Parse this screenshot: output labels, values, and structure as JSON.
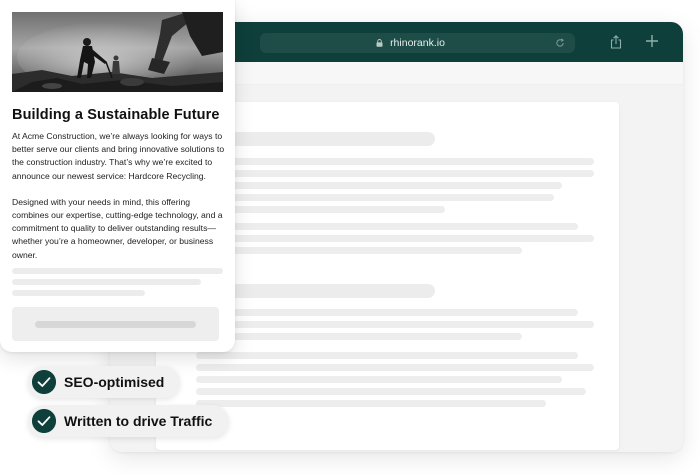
{
  "browser": {
    "url": "rhinorank.io",
    "icons": [
      "lock-icon",
      "reload-icon",
      "share-icon",
      "plus-icon"
    ],
    "bar_color": "#0e3f3a"
  },
  "card": {
    "title": "Building a Sustainable Future",
    "paragraphs": [
      "At Acme Construction, we’re always looking for ways to better serve our clients and bring innovative solutions to the construction industry. That’s why we’re excited to announce our newest service: Hardcore Recycling.",
      "Designed with your needs in mind, this offering combines our expertise, cutting-edge technology, and a commitment to quality to deliver outstanding results—whether you’re a homeowner, developer, or business owner."
    ]
  },
  "badges": [
    {
      "label": "SEO-optimised",
      "icon": "check-icon"
    },
    {
      "label": "Written to drive Traffic",
      "icon": "check-icon"
    }
  ],
  "colors": {
    "accent": "#0e3f3a",
    "placeholder": "#ededed"
  }
}
